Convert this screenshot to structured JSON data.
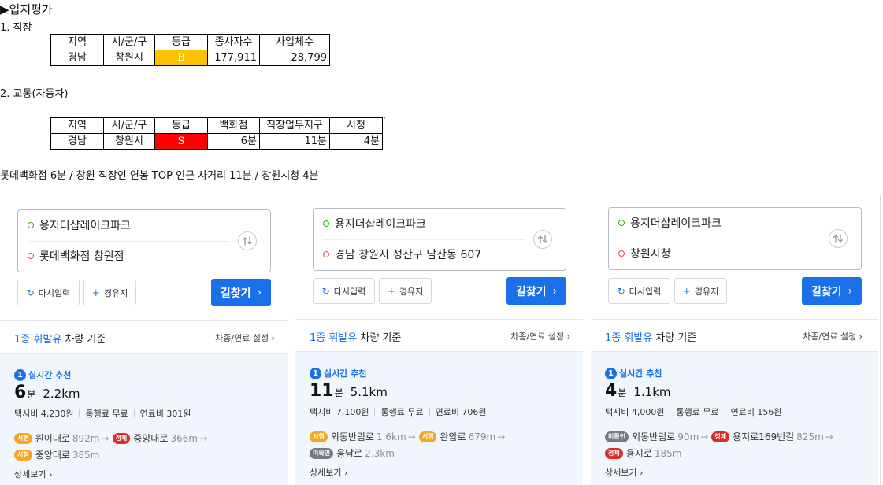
{
  "section_title": "▶입지평가",
  "workplace": {
    "heading": "1. 직장",
    "headers": [
      "지역",
      "시/군/구",
      "등급",
      "종사자수",
      "사업체수"
    ],
    "row": {
      "region": "경남",
      "city": "창원시",
      "grade": "B",
      "workers": "177,911",
      "businesses": "28,799"
    },
    "grade_color": "#ffc000"
  },
  "traffic": {
    "heading": "2. 교통(자동차)",
    "headers": [
      "지역",
      "시/군/구",
      "등급",
      "백화점",
      "직장업무지구",
      "시청"
    ],
    "row": {
      "region": "경남",
      "city": "창원시",
      "grade": "S",
      "dept_store": "6분",
      "business_district": "11분",
      "city_hall": "4분"
    },
    "grade_color": "#ff0000",
    "stray_mark": "`"
  },
  "summary_note": "롯데백화점 6분 / 창원 직장인 연봉 TOP 인근 사거리 11분  /  창원시청 4분",
  "common": {
    "reset_label": "다시입력",
    "via_label": "경유지",
    "search_label": "길찾기",
    "basis_highlight": "1종 휘발유",
    "basis_rest": " 차량 기준",
    "settings_label": "차종/연료 설정",
    "rec_number": "1",
    "rec_label": "실시간 추천",
    "detail_label": "상세보기",
    "minute_unit": "분",
    "accent_color": "#1a70e8"
  },
  "routes": [
    {
      "origin": "용지더샵레이크파크",
      "destination": "롯데백화점 창원점",
      "time": "6",
      "distance": "2.2km",
      "taxi": "택시비 4,230원",
      "toll": "통행료 무료",
      "fuel": "연료비 301원",
      "line1": [
        {
          "badge": "서행",
          "type": "slow",
          "road": "원이대로",
          "dist": "892m"
        },
        {
          "badge": "정체",
          "type": "jam",
          "road": "중앙대로",
          "dist": "366m"
        }
      ],
      "line2": [
        {
          "badge": "서행",
          "type": "slow",
          "road": "중앙대로",
          "dist": "385m"
        }
      ]
    },
    {
      "origin": "용지더샵레이크파크",
      "destination": "경남 창원시 성산구 남산동 607",
      "time": "11",
      "distance": "5.1km",
      "taxi": "택시비 7,100원",
      "toll": "통행료 무료",
      "fuel": "연료비 706원",
      "line1": [
        {
          "badge": "서행",
          "type": "slow",
          "road": "외동반림로",
          "dist": "1.6km"
        },
        {
          "badge": "서행",
          "type": "slow",
          "road": "완암로",
          "dist": "679m"
        }
      ],
      "line2": [
        {
          "badge": "미확인",
          "type": "unk",
          "road": "웅남로",
          "dist": "2.3km"
        }
      ]
    },
    {
      "origin": "용지더샵레이크파크",
      "destination": "창원시청",
      "time": "4",
      "distance": "1.1km",
      "taxi": "택시비 4,000원",
      "toll": "통행료 무료",
      "fuel": "연료비 156원",
      "line1": [
        {
          "badge": "미확인",
          "type": "unk",
          "road": "외동반림로",
          "dist": "90m"
        },
        {
          "badge": "정체",
          "type": "jam",
          "road": "용지로169번길",
          "dist": "825m"
        }
      ],
      "line2": [
        {
          "badge": "정체",
          "type": "jam",
          "road": "용지로",
          "dist": "185m"
        }
      ]
    }
  ]
}
